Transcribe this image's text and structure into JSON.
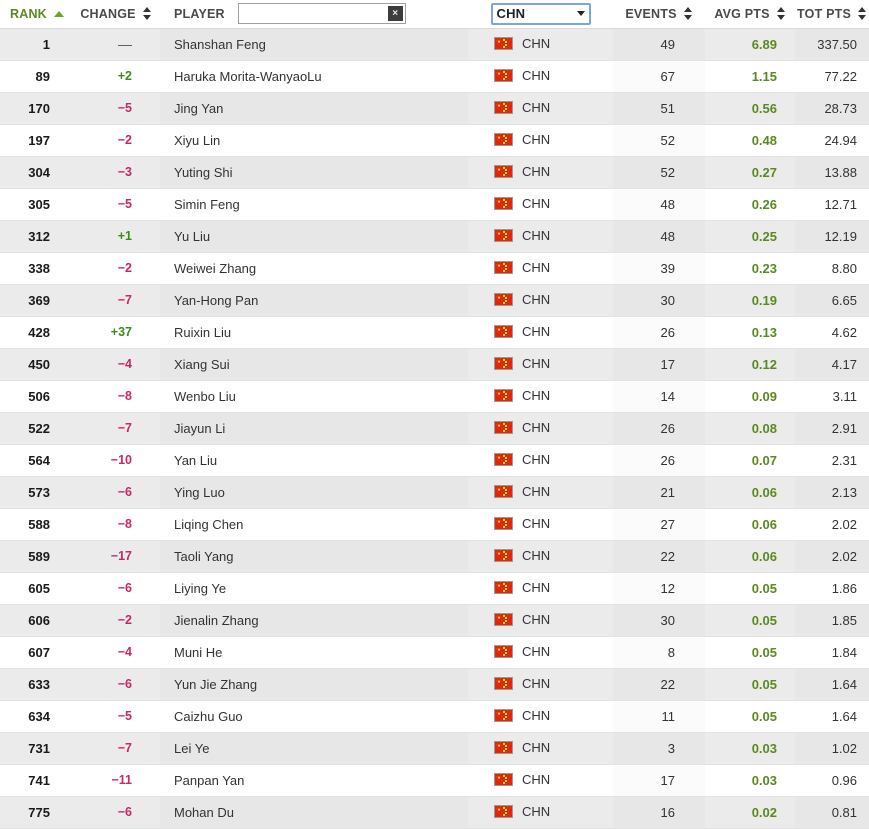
{
  "table": {
    "columns": {
      "rank": "RANK",
      "change": "CHANGE",
      "player": "PLAYER",
      "country": "",
      "events": "EVENTS",
      "avg_pts": "AVG PTS",
      "tot_pts": "TOT PTS"
    },
    "sort": {
      "active_column": "RANK",
      "direction": "asc",
      "asc_icon": "triangle-up-icon",
      "sortable_icon": "sort-updown-icon"
    },
    "accent_colors": {
      "active_sort_green": "#5a8a1e",
      "change_up_green": "#3f8a1c",
      "change_down_pink": "#c6286b",
      "avg_pts_green": "#5a8a1e",
      "row_alt_gray": "#eeeeee",
      "select_focus_blue": "#7aa7e0",
      "flag_red": "#de2910",
      "flag_yellow": "#ffde00"
    }
  },
  "search": {
    "value": "",
    "placeholder": "",
    "clear_label": "×",
    "clear_icon": "close-icon"
  },
  "country_filter": {
    "selected": "CHN",
    "caret_icon": "chevron-down-icon"
  },
  "rows": [
    {
      "rank": "1",
      "change": "—",
      "dir": "flat",
      "player": "Shanshan Feng",
      "country": "CHN",
      "events": "49",
      "avg": "6.89",
      "tot": "337.50"
    },
    {
      "rank": "89",
      "change": "+2",
      "dir": "up",
      "player": "Haruka Morita-WanyaoLu",
      "country": "CHN",
      "events": "67",
      "avg": "1.15",
      "tot": "77.22"
    },
    {
      "rank": "170",
      "change": "−5",
      "dir": "down",
      "player": "Jing Yan",
      "country": "CHN",
      "events": "51",
      "avg": "0.56",
      "tot": "28.73"
    },
    {
      "rank": "197",
      "change": "−2",
      "dir": "down",
      "player": "Xiyu Lin",
      "country": "CHN",
      "events": "52",
      "avg": "0.48",
      "tot": "24.94"
    },
    {
      "rank": "304",
      "change": "−3",
      "dir": "down",
      "player": "Yuting Shi",
      "country": "CHN",
      "events": "52",
      "avg": "0.27",
      "tot": "13.88"
    },
    {
      "rank": "305",
      "change": "−5",
      "dir": "down",
      "player": "Simin Feng",
      "country": "CHN",
      "events": "48",
      "avg": "0.26",
      "tot": "12.71"
    },
    {
      "rank": "312",
      "change": "+1",
      "dir": "up",
      "player": "Yu Liu",
      "country": "CHN",
      "events": "48",
      "avg": "0.25",
      "tot": "12.19"
    },
    {
      "rank": "338",
      "change": "−2",
      "dir": "down",
      "player": "Weiwei Zhang",
      "country": "CHN",
      "events": "39",
      "avg": "0.23",
      "tot": "8.80"
    },
    {
      "rank": "369",
      "change": "−7",
      "dir": "down",
      "player": "Yan-Hong Pan",
      "country": "CHN",
      "events": "30",
      "avg": "0.19",
      "tot": "6.65"
    },
    {
      "rank": "428",
      "change": "+37",
      "dir": "up",
      "player": "Ruixin Liu",
      "country": "CHN",
      "events": "26",
      "avg": "0.13",
      "tot": "4.62"
    },
    {
      "rank": "450",
      "change": "−4",
      "dir": "down",
      "player": "Xiang Sui",
      "country": "CHN",
      "events": "17",
      "avg": "0.12",
      "tot": "4.17"
    },
    {
      "rank": "506",
      "change": "−8",
      "dir": "down",
      "player": "Wenbo Liu",
      "country": "CHN",
      "events": "14",
      "avg": "0.09",
      "tot": "3.11"
    },
    {
      "rank": "522",
      "change": "−7",
      "dir": "down",
      "player": "Jiayun Li",
      "country": "CHN",
      "events": "26",
      "avg": "0.08",
      "tot": "2.91"
    },
    {
      "rank": "564",
      "change": "−10",
      "dir": "down",
      "player": "Yan Liu",
      "country": "CHN",
      "events": "26",
      "avg": "0.07",
      "tot": "2.31"
    },
    {
      "rank": "573",
      "change": "−6",
      "dir": "down",
      "player": "Ying Luo",
      "country": "CHN",
      "events": "21",
      "avg": "0.06",
      "tot": "2.13"
    },
    {
      "rank": "588",
      "change": "−8",
      "dir": "down",
      "player": "Liqing Chen",
      "country": "CHN",
      "events": "27",
      "avg": "0.06",
      "tot": "2.02"
    },
    {
      "rank": "589",
      "change": "−17",
      "dir": "down",
      "player": "Taoli Yang",
      "country": "CHN",
      "events": "22",
      "avg": "0.06",
      "tot": "2.02"
    },
    {
      "rank": "605",
      "change": "−6",
      "dir": "down",
      "player": "Liying Ye",
      "country": "CHN",
      "events": "12",
      "avg": "0.05",
      "tot": "1.86"
    },
    {
      "rank": "606",
      "change": "−2",
      "dir": "down",
      "player": "Jienalin Zhang",
      "country": "CHN",
      "events": "30",
      "avg": "0.05",
      "tot": "1.85"
    },
    {
      "rank": "607",
      "change": "−4",
      "dir": "down",
      "player": "Muni He",
      "country": "CHN",
      "events": "8",
      "avg": "0.05",
      "tot": "1.84"
    },
    {
      "rank": "633",
      "change": "−6",
      "dir": "down",
      "player": "Yun Jie Zhang",
      "country": "CHN",
      "events": "22",
      "avg": "0.05",
      "tot": "1.64"
    },
    {
      "rank": "634",
      "change": "−5",
      "dir": "down",
      "player": "Caizhu Guo",
      "country": "CHN",
      "events": "11",
      "avg": "0.05",
      "tot": "1.64"
    },
    {
      "rank": "731",
      "change": "−7",
      "dir": "down",
      "player": "Lei Ye",
      "country": "CHN",
      "events": "3",
      "avg": "0.03",
      "tot": "1.02"
    },
    {
      "rank": "741",
      "change": "−11",
      "dir": "down",
      "player": "Panpan Yan",
      "country": "CHN",
      "events": "17",
      "avg": "0.03",
      "tot": "0.96"
    },
    {
      "rank": "775",
      "change": "−6",
      "dir": "down",
      "player": "Mohan Du",
      "country": "CHN",
      "events": "16",
      "avg": "0.02",
      "tot": "0.81"
    }
  ]
}
